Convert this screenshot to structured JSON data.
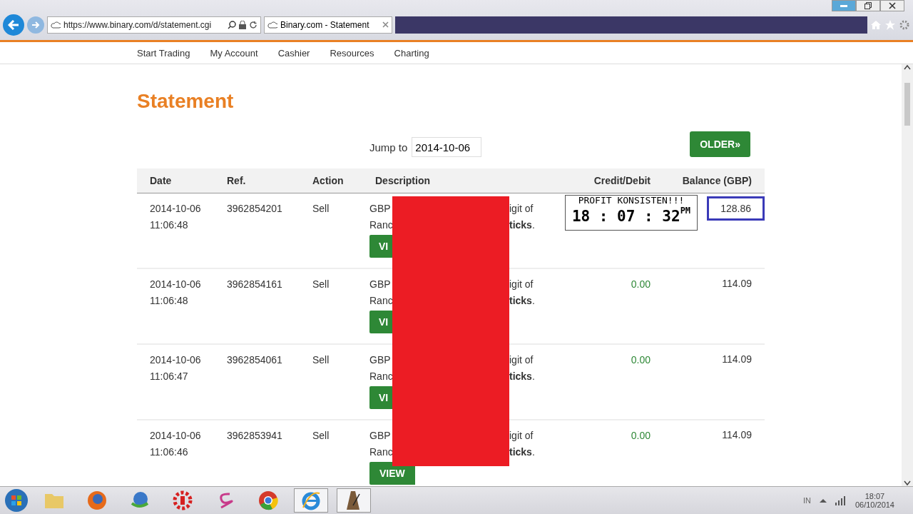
{
  "browser": {
    "url": "https://www.binary.com/d/statement.cgi",
    "tab_title": "Binary.com - Statement"
  },
  "nav": [
    "Start Trading",
    "My Account",
    "Cashier",
    "Resources",
    "Charting"
  ],
  "page_title": "Statement",
  "jump": {
    "label": "Jump to",
    "value": "2014-10-06"
  },
  "older_button": "OLDER»",
  "columns": [
    "Date",
    "Ref.",
    "Action",
    "Description",
    "Credit/Debit",
    "Balance (GBP)"
  ],
  "rows": [
    {
      "date": "2014-10-06",
      "time": "11:06:48",
      "ref": "3962854201",
      "action": "Sell",
      "desc_left": [
        "GBP",
        "Ranc"
      ],
      "desc_right": [
        "igit of",
        "**ticks**."
      ],
      "button": "VI",
      "button_covered": true,
      "credit": "",
      "balance": "128.86",
      "outlined": true
    },
    {
      "date": "2014-10-06",
      "time": "11:06:48",
      "ref": "3962854161",
      "action": "Sell",
      "desc_left": [
        "GBP",
        "Ranc"
      ],
      "desc_right": [
        "igit of",
        "**ticks**."
      ],
      "button": "VI",
      "button_covered": true,
      "credit": "0.00",
      "balance": "114.09",
      "outlined": false
    },
    {
      "date": "2014-10-06",
      "time": "11:06:47",
      "ref": "3962854061",
      "action": "Sell",
      "desc_left": [
        "GBP",
        "Ranc"
      ],
      "desc_right": [
        "igit of",
        "**ticks**."
      ],
      "button": "VI",
      "button_covered": true,
      "credit": "0.00",
      "balance": "114.09",
      "outlined": false
    },
    {
      "date": "2014-10-06",
      "time": "11:06:46",
      "ref": "3962853941",
      "action": "Sell",
      "desc_left": [
        "GBP",
        "Ranc"
      ],
      "desc_right": [
        "igit of",
        "**ticks**."
      ],
      "button": "VIEW",
      "button_covered": false,
      "credit": "0.00",
      "balance": "114.09",
      "outlined": false
    }
  ],
  "clock_overlay": {
    "caption": "PROFIT KONSISTEN!!!",
    "time": "18 : 07 : 32",
    "suffix": "PM"
  },
  "taskbar": {
    "items": [
      {
        "kind": "folder",
        "selected": false
      },
      {
        "kind": "firefox",
        "selected": false
      },
      {
        "kind": "download",
        "selected": false
      },
      {
        "kind": "gear",
        "selected": false
      },
      {
        "kind": "swirl",
        "selected": false
      },
      {
        "kind": "chrome",
        "selected": false
      },
      {
        "kind": "ie",
        "selected": true
      },
      {
        "kind": "metronome",
        "selected": true
      }
    ],
    "language": "IN",
    "time": "18:07",
    "date": "06/10/2014"
  }
}
